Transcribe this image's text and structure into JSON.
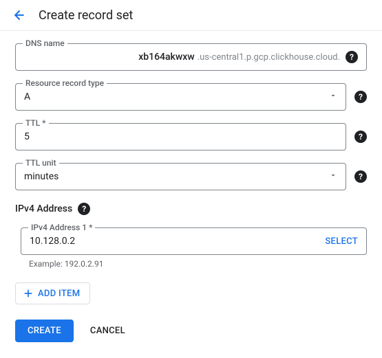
{
  "header": {
    "title": "Create record set"
  },
  "fields": {
    "dns": {
      "label": "DNS name",
      "value_prefix": "xb164akwxw",
      "value_suffix": ".us-central1.p.gcp.clickhouse.cloud."
    },
    "record_type": {
      "label": "Resource record type",
      "value": "A"
    },
    "ttl": {
      "label": "TTL *",
      "value": "5"
    },
    "ttl_unit": {
      "label": "TTL unit",
      "value": "minutes"
    }
  },
  "ipv4": {
    "section_title": "IPv4 Address",
    "address1": {
      "label": "IPv4 Address 1 *",
      "value": "10.128.0.2",
      "select_label": "SELECT"
    },
    "example": "Example: 192.0.2.91",
    "add_item_label": "ADD ITEM"
  },
  "buttons": {
    "create": "CREATE",
    "cancel": "CANCEL"
  }
}
